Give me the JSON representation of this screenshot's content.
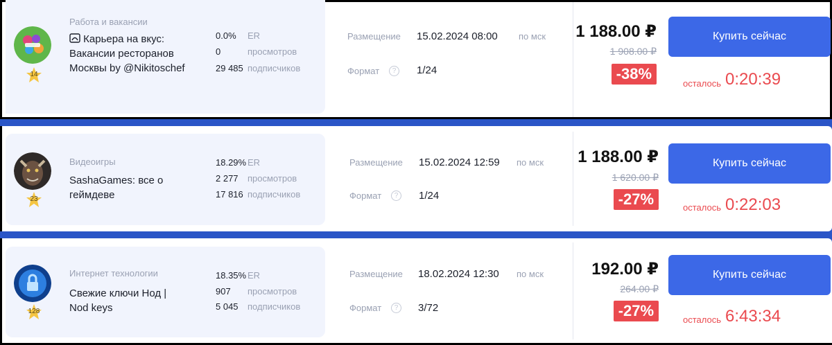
{
  "listings": [
    {
      "category": "Работа и вакансии",
      "title_prefix_icon": "food-tray-icon",
      "title": "Карьера на вкус: Вакансии ресторанов Москвы by @Nikitoschef",
      "level": "14",
      "avatar_color": "#5fb64a",
      "er_value": "0.0%",
      "er_label": "ER",
      "views_value": "0",
      "views_label": "просмотров",
      "subs_value": "29 485",
      "subs_label": "подписчиков",
      "placement_label": "Размещение",
      "placement_value": "15.02.2024 08:00",
      "tz": "по мск",
      "format_label": "Формат",
      "format_value": "1/24",
      "price": "1 188.00 ₽",
      "old_price": "1 908.00 ₽",
      "discount": "-38%",
      "buy_label": "Купить сейчас",
      "left_label": "осталось",
      "timer": "0:20:39"
    },
    {
      "category": "Видеоигры",
      "title": "SashaGames: все о геймдеве",
      "level": "23",
      "avatar_color": "#4a3a30",
      "er_value": "18.29%",
      "er_label": "ER",
      "views_value": "2 277",
      "views_label": "просмотров",
      "subs_value": "17 816",
      "subs_label": "подписчиков",
      "placement_label": "Размещение",
      "placement_value": "15.02.2024 12:59",
      "tz": "по мск",
      "format_label": "Формат",
      "format_value": "1/24",
      "price": "1 188.00 ₽",
      "old_price": "1 620.00 ₽",
      "discount": "-27%",
      "buy_label": "Купить сейчас",
      "left_label": "осталось",
      "timer": "0:22:03"
    },
    {
      "category": "Интернет технологии",
      "title": "Свежие ключи Нод | Nod keys",
      "level": "128",
      "avatar_color": "#1f5fb8",
      "er_value": "18.35%",
      "er_label": "ER",
      "views_value": "907",
      "views_label": "просмотров",
      "subs_value": "5 045",
      "subs_label": "подписчиков",
      "placement_label": "Размещение",
      "placement_value": "18.02.2024 12:30",
      "tz": "по мск",
      "format_label": "Формат",
      "format_value": "3/72",
      "price": "192.00 ₽",
      "old_price": "264.00 ₽",
      "discount": "-27%",
      "buy_label": "Купить сейчас",
      "left_label": "осталось",
      "timer": "6:43:34"
    }
  ],
  "colors": {
    "accent_blue": "#3c68e7",
    "discount_red": "#ea4a4f",
    "panel_bg": "#f1f4fd",
    "star_gold": "#f5c542"
  },
  "icons": {
    "help": "?",
    "star": "star-icon"
  }
}
